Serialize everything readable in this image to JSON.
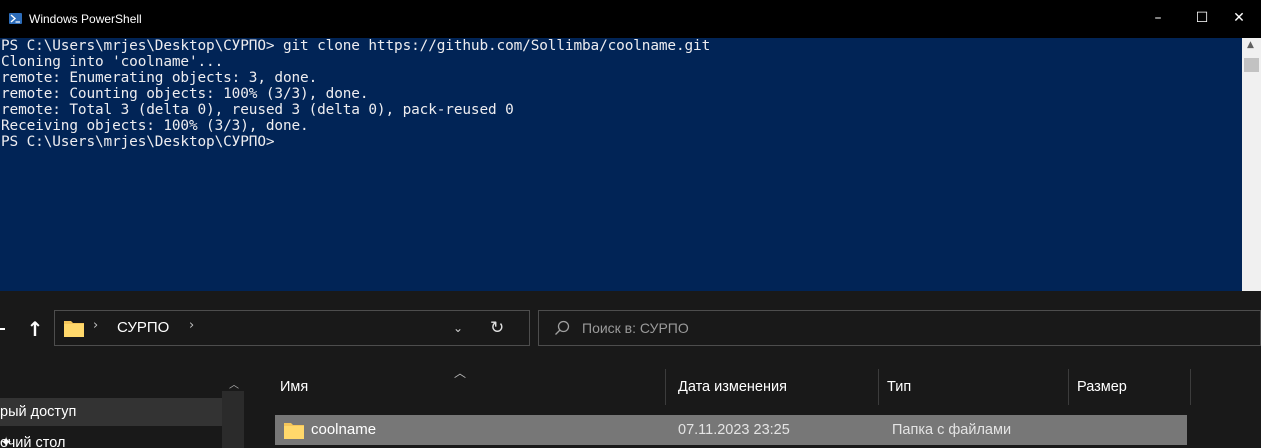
{
  "powershell": {
    "title": "Windows PowerShell",
    "controls": {
      "minimize": "–",
      "maximize": "☐",
      "close": "✕"
    },
    "lines": [
      "PS C:\\Users\\mrjes\\Desktop\\СУРПО> git clone https://github.com/Sollimba/coolname.git",
      "Cloning into 'coolname'...",
      "remote: Enumerating objects: 3, done.",
      "remote: Counting objects: 100% (3/3), done.",
      "remote: Total 3 (delta 0), reused 3 (delta 0), pack-reused 0",
      "Receiving objects: 100% (3/3), done.",
      "PS C:\\Users\\mrjes\\Desktop\\СУРПО>"
    ],
    "colors": {
      "background": "#012456",
      "text": "#eeedf0",
      "titlebar": "#000000"
    }
  },
  "explorer": {
    "address": {
      "crumb": "СУРПО",
      "separator": "›"
    },
    "search": {
      "placeholder": "Поиск в: СУРПО"
    },
    "nav": {
      "items": [
        {
          "label": "рый доступ"
        },
        {
          "label": "очий стол"
        }
      ]
    },
    "columns": [
      "Имя",
      "Дата изменения",
      "Тип",
      "Размер"
    ],
    "rows": [
      {
        "name": "coolname",
        "date": "07.11.2023 23:25",
        "type": "Папка с файлами",
        "size": ""
      }
    ],
    "colors": {
      "background": "#191919",
      "selected_row": "#777777",
      "folder": "#f4c55a"
    }
  }
}
